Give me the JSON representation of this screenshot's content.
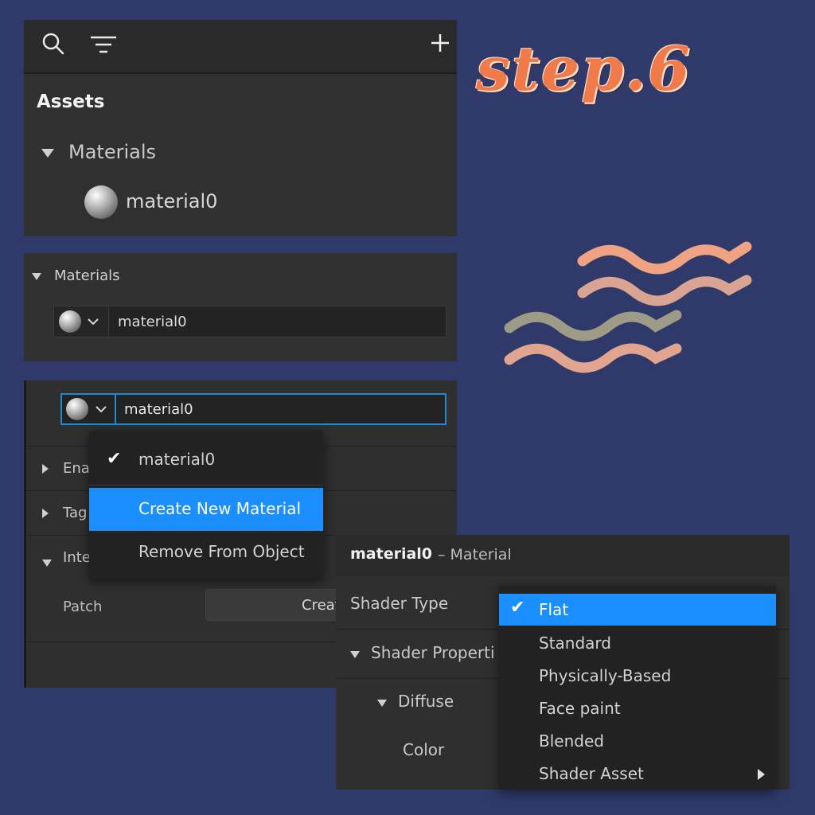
{
  "step_title": "step.6",
  "assets_panel": {
    "title": "Assets",
    "section_label": "Materials",
    "item_label": "material0"
  },
  "materials_panel": {
    "section_label": "Materials",
    "field_value": "material0"
  },
  "object_panel": {
    "field_value": "material0",
    "rows": [
      "Ena",
      "Tag",
      "Inte"
    ],
    "patch_label": "Patch",
    "create_button_label": "Creat"
  },
  "material_menu": {
    "items": [
      "material0",
      "Create New Material",
      "Remove From Object"
    ],
    "checked": "material0",
    "highlighted": "Create New Material"
  },
  "material_inspector": {
    "name": "material0",
    "subtitle": "– Material",
    "shader_type_label": "Shader Type",
    "shader_properties_label": "Shader Properti",
    "diffuse_label": "Diffuse",
    "color_label": "Color"
  },
  "shader_menu": {
    "items": [
      "Flat",
      "Standard",
      "Physically-Based",
      "Face paint",
      "Blended",
      "Shader Asset"
    ],
    "checked": "Flat",
    "highlighted": "Flat"
  },
  "colors": {
    "background": "#2f3a6a",
    "accent": "#1b8fff",
    "step_title": "#f07a4a",
    "wave_1": "#f0a383",
    "wave_2": "#d9a491",
    "wave_3": "#9d9a86",
    "wave_4": "#e0a48f"
  }
}
